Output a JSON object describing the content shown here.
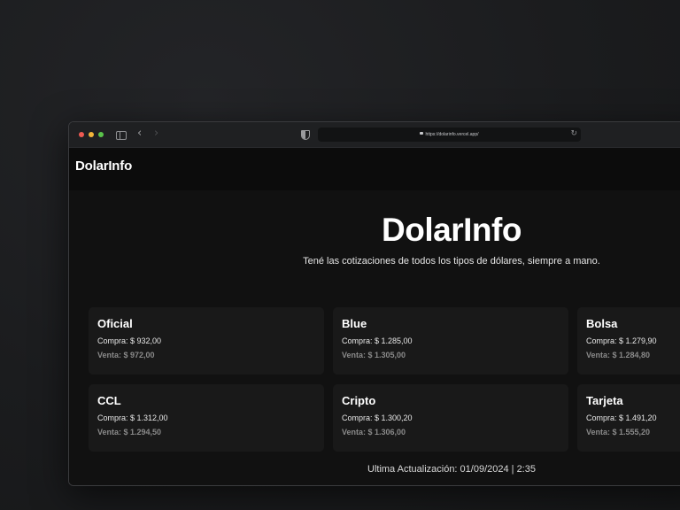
{
  "browser": {
    "url": "https://dolarinfo.vercel.app/",
    "back_glyph": "‹",
    "forward_glyph": "›",
    "reload_glyph": "↻"
  },
  "navbar": {
    "brand": "DolarInfo"
  },
  "hero": {
    "title": "DolarInfo",
    "subtitle": "Tené las cotizaciones de todos los tipos de dólares, siempre a mano."
  },
  "cards": [
    {
      "name": "Oficial",
      "buy": "Compra: $ 932,00",
      "sell": "Venta: $ 972,00"
    },
    {
      "name": "Blue",
      "buy": "Compra: $ 1.285,00",
      "sell": "Venta: $ 1.305,00"
    },
    {
      "name": "Bolsa",
      "buy": "Compra: $ 1.279,90",
      "sell": "Venta: $ 1.284,80"
    },
    {
      "name": "CCL",
      "buy": "Compra: $ 1.312,00",
      "sell": "Venta: $ 1.294,50"
    },
    {
      "name": "Cripto",
      "buy": "Compra: $ 1.300,20",
      "sell": "Venta: $ 1.306,00"
    },
    {
      "name": "Tarjeta",
      "buy": "Compra: $ 1.491,20",
      "sell": "Venta: $ 1.555,20"
    }
  ],
  "footer": {
    "last_update": "Ultima Actualización: 01/09/2024 | 2:35"
  },
  "colors": {
    "window_bg": "#0d0d0d",
    "card_bg": "#191919",
    "sell_text": "#8a8a8a",
    "dot_red": "#ee5a52",
    "dot_yellow": "#f2b53a",
    "dot_green": "#5ac34a"
  }
}
